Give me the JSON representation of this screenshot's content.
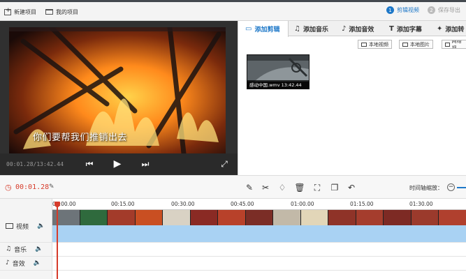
{
  "topbar": {
    "new_project": "新建项目",
    "my_projects": "我的项目",
    "steps": [
      {
        "num": "1",
        "label": "剪辑视频",
        "color": "#1e78c8"
      },
      {
        "num": "2",
        "label": "保存导出",
        "color": "#bbbbbb"
      }
    ]
  },
  "player": {
    "subtitle": "你们要帮我们推销出去",
    "timecode": "00:01.28/13:42.44"
  },
  "tabs": [
    {
      "label": "添加剪辑",
      "icon": "film-icon"
    },
    {
      "label": "添加音乐",
      "icon": "music-note-icon"
    },
    {
      "label": "添加音效",
      "icon": "sound-effect-icon"
    },
    {
      "label": "添加字幕",
      "icon": "text-icon"
    },
    {
      "label": "添加转",
      "icon": "transition-icon"
    }
  ],
  "sources": {
    "local_video": "本地视频",
    "local_image": "本地图片",
    "network": "网络视"
  },
  "clip": {
    "caption": "感动中国.wmv 13:42.44"
  },
  "toolbar": {
    "current_time": "00:01.28",
    "zoom_label": "时间轴缩放："
  },
  "timeline": {
    "ruler_ticks": [
      "00:00.00",
      "00:15.00",
      "00:30.00",
      "00:45.00",
      "01:00.00",
      "01:15.00",
      "01:30.00"
    ],
    "tracks": [
      {
        "label": "视频",
        "icon": "video-track-icon"
      },
      {
        "label": "音乐",
        "icon": "music-track-icon"
      },
      {
        "label": "音效",
        "icon": "sound-effect-track-icon"
      }
    ]
  },
  "colors": {
    "accent_blue": "#1e78c8",
    "playhead_red": "#d63b2a",
    "video_track": "#9fc9ec"
  }
}
